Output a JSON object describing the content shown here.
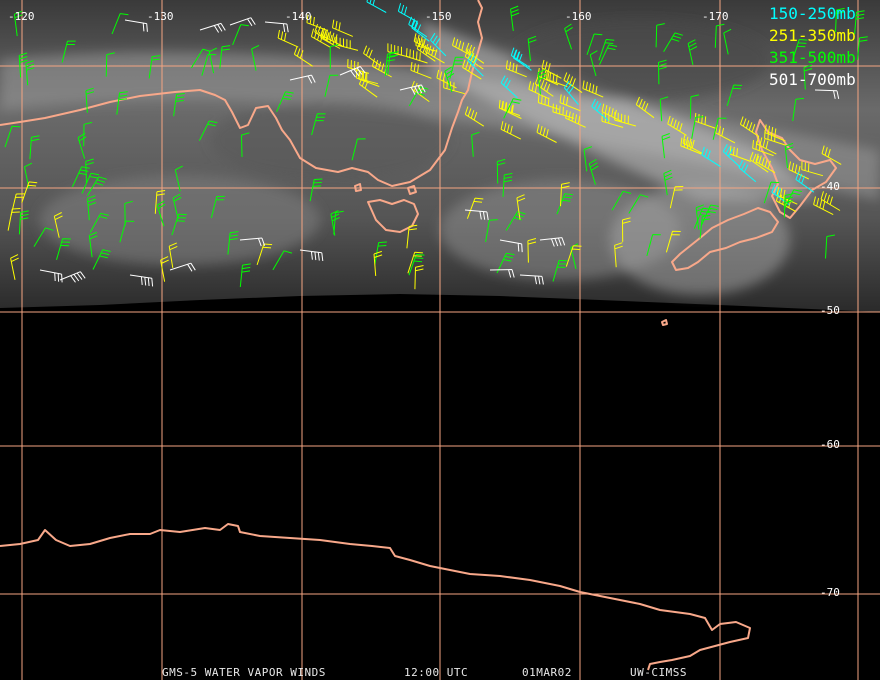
{
  "legend": [
    {
      "label": "150-250mb",
      "color": "#00ffff"
    },
    {
      "label": "251-350mb",
      "color": "#ffff00"
    },
    {
      "label": "351-500mb",
      "color": "#00ff00"
    },
    {
      "label": "501-700mb",
      "color": "#ffffff"
    }
  ],
  "lon_labels": [
    "-120",
    "-130",
    "-140",
    "-150",
    "-160",
    "-170"
  ],
  "lat_labels": [
    "-40",
    "-50",
    "-60",
    "-70"
  ],
  "footer": {
    "product": "GMS-5 WATER VAPOR WINDS",
    "time": "12:00 UTC",
    "date": "01MAR02",
    "source": "UW-CIMSS"
  },
  "colors": {
    "grid": "#f4a582",
    "coast": "#f8a88a",
    "background": "#000000"
  }
}
